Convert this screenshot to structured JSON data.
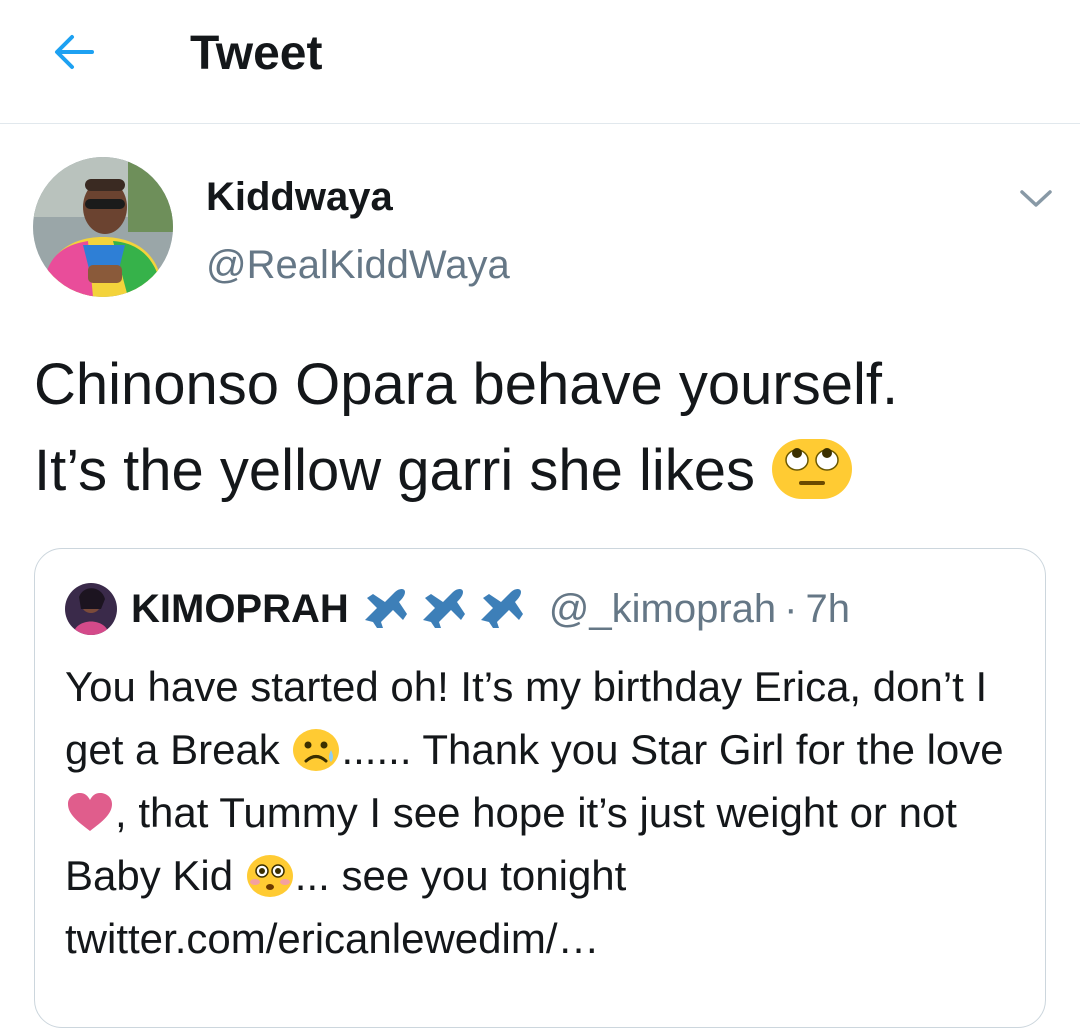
{
  "header": {
    "title": "Tweet",
    "back_icon": "arrow-left-icon"
  },
  "tweet": {
    "author": {
      "display_name": "Kiddwaya",
      "handle": "@RealKiddWaya"
    },
    "menu_icon": "chevron-down-icon",
    "text_line1": "Chinonso Opara behave yourself.",
    "text_line2": "It’s the yellow garri she likes",
    "text_emoji": "face-with-rolling-eyes"
  },
  "quote": {
    "display_name": "KIMOPRAH",
    "name_emojis": [
      "airplane",
      "airplane",
      "airplane"
    ],
    "handle": "@_kimoprah",
    "separator": "·",
    "time": "7h",
    "text_1": "You have started oh! It’s my birthday Erica, don’t I get a Break ",
    "text_2": "......  Thank you Star Girl for the love ",
    "text_3": ", that Tummy I see hope it’s just weight or not Baby Kid ",
    "text_4": "... see you tonight twitter.com/ericanlewedim/…",
    "emojis": [
      "sad-face-with-tear",
      "heart",
      "flushed-face"
    ]
  },
  "colors": {
    "accent": "#1da1f2",
    "muted": "#657786",
    "border": "#e1e8ed",
    "heart": "#e05d8c",
    "emoji_yellow": "#ffcb33"
  }
}
